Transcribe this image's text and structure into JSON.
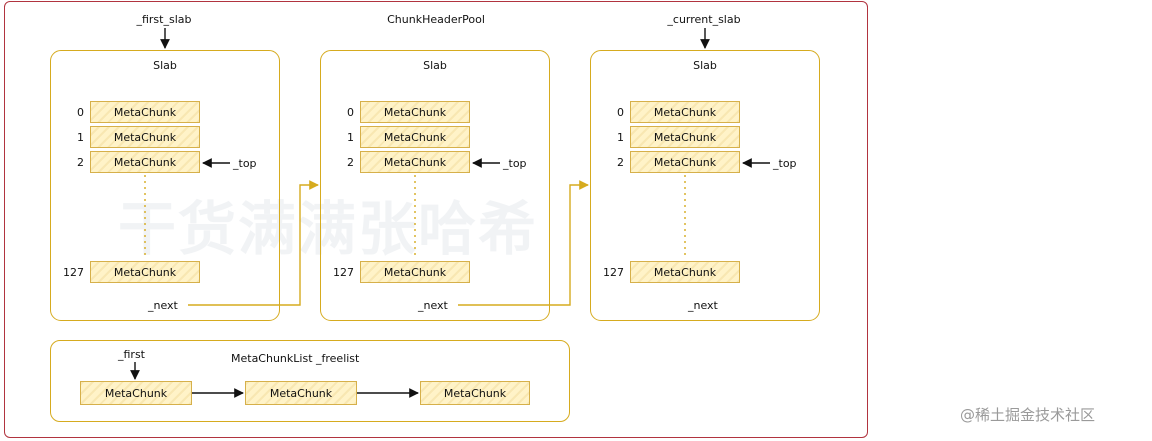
{
  "diagram": {
    "pool_title": "ChunkHeaderPool",
    "pointers": {
      "first_slab": "_first_slab",
      "current_slab": "_current_slab"
    },
    "slabs": [
      {
        "title": "Slab",
        "indices": [
          "0",
          "1",
          "2",
          "127"
        ],
        "chunks": [
          "MetaChunk",
          "MetaChunk",
          "MetaChunk",
          "MetaChunk"
        ],
        "top_label": "_top",
        "next_label": "_next"
      },
      {
        "title": "Slab",
        "indices": [
          "0",
          "1",
          "2",
          "127"
        ],
        "chunks": [
          "MetaChunk",
          "MetaChunk",
          "MetaChunk",
          "MetaChunk"
        ],
        "top_label": "_top",
        "next_label": "_next"
      },
      {
        "title": "Slab",
        "indices": [
          "0",
          "1",
          "2",
          "127"
        ],
        "chunks": [
          "MetaChunk",
          "MetaChunk",
          "MetaChunk",
          "MetaChunk"
        ],
        "top_label": "_top",
        "next_label": "_next"
      }
    ],
    "freelist": {
      "title": "MetaChunkList _freelist",
      "first_label": "_first",
      "chunks": [
        "MetaChunk",
        "MetaChunk",
        "MetaChunk"
      ]
    },
    "watermark_text": "干货满满张哈希",
    "colors": {
      "frame": "#b1343f",
      "slab_border": "#d6ab1f",
      "chunk_fill": "#fff3c8",
      "chunk_border": "#d6b04a",
      "next_arrow": "#d6ab1f"
    }
  },
  "footer": {
    "watermark": "@稀土掘金技术社区"
  }
}
